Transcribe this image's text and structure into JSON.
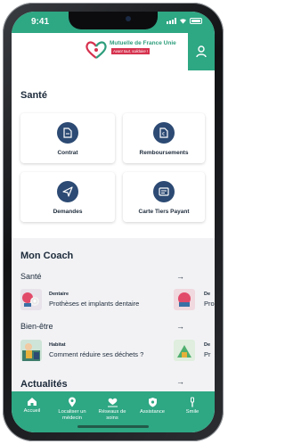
{
  "status": {
    "time": "9:41"
  },
  "brand": {
    "name": "Mutuelle de France Unie",
    "tagline": "Avant tout, solidaire !"
  },
  "sante": {
    "title": "Santé",
    "cards": [
      {
        "label": "Contrat",
        "icon": "document-icon"
      },
      {
        "label": "Remboursements",
        "icon": "euro-document-icon"
      },
      {
        "label": "Demandes",
        "icon": "send-icon"
      },
      {
        "label": "Carte Tiers Payant",
        "icon": "card-icon"
      }
    ]
  },
  "coach": {
    "title": "Mon Coach",
    "arrow": "→",
    "sante_label": "Santé",
    "sante_items": [
      {
        "category": "Dentaire",
        "title": "Prothèses et implants dentaire"
      },
      {
        "category": "De",
        "title": "Pro"
      }
    ],
    "bienetre_label": "Bien-être",
    "bienetre_items": [
      {
        "category": "Habitat",
        "title": "Comment réduire ses déchets ?"
      },
      {
        "category": "De",
        "title": "Pr"
      }
    ]
  },
  "actualites": {
    "title": "Actualités"
  },
  "tabs": [
    {
      "label": "Accueil",
      "icon": "home-icon"
    },
    {
      "label": "Localiser un médecin",
      "icon": "location-pin-icon"
    },
    {
      "label": "Réseaux de soins",
      "icon": "heart-hand-icon"
    },
    {
      "label": "Assistance",
      "icon": "shield-icon"
    },
    {
      "label": "Smile",
      "icon": "toothbrush-icon"
    }
  ],
  "colors": {
    "brand_green": "#2ea783",
    "navy": "#2c4a73",
    "logo_red": "#d6324e"
  }
}
